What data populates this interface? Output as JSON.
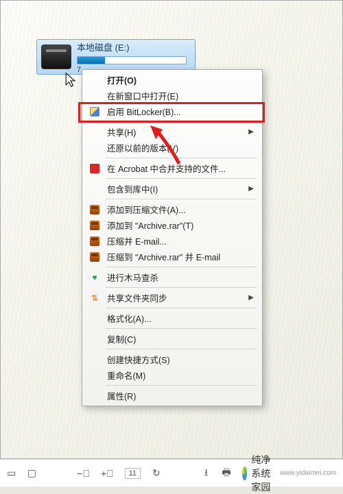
{
  "drive": {
    "label": "本地磁盘 (E:)",
    "size_hint": "7"
  },
  "menu": {
    "open": "打开(O)",
    "open_new_window": "在新窗口中打开(E)",
    "enable_bitlocker": "启用 BitLocker(B)...",
    "share": "共享(H)",
    "restore_versions": "还原以前的版本(V)",
    "acrobat": "在 Acrobat 中合并支持的文件...",
    "include_in_library": "包含到库中(I)",
    "add_to_archive": "添加到压缩文件(A)...",
    "add_to_archive_rar": "添加到 \"Archive.rar\"(T)",
    "compress_email": "压缩并 E-mail...",
    "compress_to_rar_email": "压缩到 \"Archive.rar\" 并 E-mail",
    "trojan_scan": "进行木马查杀",
    "folder_sync": "共享文件夹同步",
    "format": "格式化(A)...",
    "copy": "复制(C)",
    "create_shortcut": "创建快捷方式(S)",
    "rename": "重命名(M)",
    "properties": "属性(R)"
  },
  "toolbar": {
    "page_current": "11"
  },
  "branding": {
    "name": "纯净系统家园",
    "url": "www.yidaimei.com"
  }
}
